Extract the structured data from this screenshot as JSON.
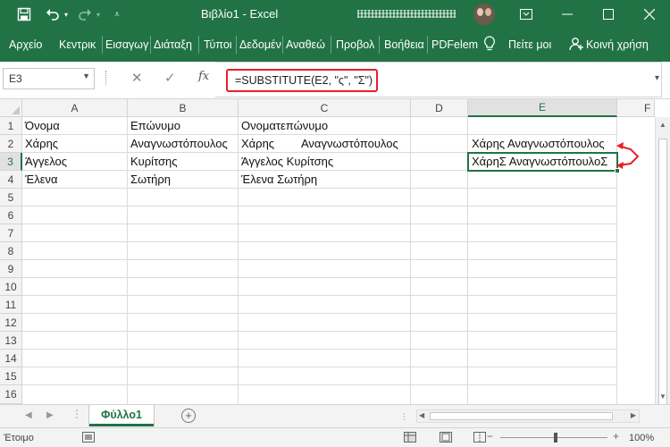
{
  "window": {
    "title": "Βιβλίο1 - Excel",
    "colors": {
      "brand": "#217346",
      "highlight": "#e8202a"
    }
  },
  "quick_access": {
    "icons": [
      "save-icon",
      "undo-icon",
      "redo-icon",
      "customize-icon"
    ]
  },
  "window_controls": {
    "icons": [
      "ribbon-display-icon",
      "minimize-icon",
      "maximize-icon",
      "close-icon"
    ]
  },
  "ribbon": {
    "tabs": [
      {
        "label": "Αρχείο"
      },
      {
        "label": "Κεντρικ"
      },
      {
        "label": "Εισαγωγ"
      },
      {
        "label": "Διάταξη"
      },
      {
        "label": "Τύποι"
      },
      {
        "label": "Δεδομέν"
      },
      {
        "label": "Αναθεώ"
      },
      {
        "label": "Προβολ"
      },
      {
        "label": "Βοήθεια"
      },
      {
        "label": "PDFelem"
      }
    ],
    "tell_me": "Πείτε μοι",
    "share": "Κοινή χρήση"
  },
  "formula_bar": {
    "name_box": "E3",
    "fx_label": "fx",
    "formula": "=SUBSTITUTE(E2, \"ς\", \"Σ\")"
  },
  "grid": {
    "columns": [
      "A",
      "B",
      "C",
      "D",
      "E",
      "F"
    ],
    "selected_column": "E",
    "rows": [
      "1",
      "2",
      "3",
      "4",
      "5",
      "6",
      "7",
      "8",
      "9",
      "10",
      "11",
      "12",
      "13",
      "14",
      "15",
      "16"
    ],
    "selected_row": "3",
    "cells": {
      "A1": "Όνομα",
      "B1": "Επώνυμο",
      "C1": "Ονοματεπώνυμο",
      "A2": "Χάρης",
      "B2": "Αναγνωστόπουλος",
      "C2_first": "Χάρης",
      "C2_last": "Αναγνωστόπουλος",
      "E2": "Χάρης Αναγνωστόπουλος",
      "A3": "Άγγελος",
      "B3": "Κυρίτσης",
      "C3": "Άγγελος Κυρίτσης",
      "E3": "ΧάρηΣ ΑναγνωστόπουλοΣ",
      "A4": "Έλενα",
      "B4": "Σωτήρη",
      "C4": "Έλενα Σωτήρη"
    }
  },
  "sheets": {
    "tabs": [
      {
        "label": "Φύλλο1",
        "active": true
      }
    ],
    "add_label": "+"
  },
  "status_bar": {
    "ready": "Έτοιμο",
    "zoom": "100%"
  }
}
